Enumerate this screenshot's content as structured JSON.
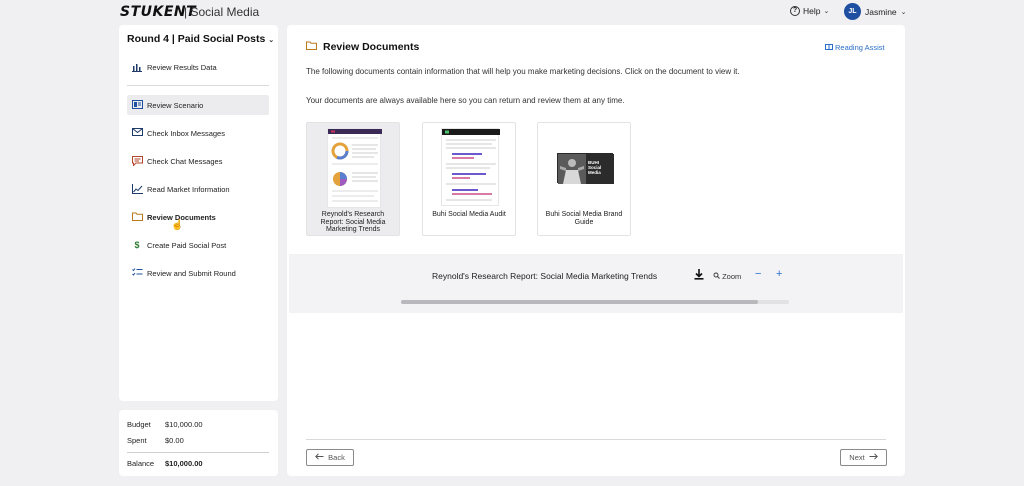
{
  "app": {
    "logo_text": "STUKENT",
    "product": "| Social Media"
  },
  "header": {
    "help_label": "Help",
    "user_initials": "JL",
    "user_name": "Jasmine"
  },
  "sidebar": {
    "round_title": "Round 4 | Paid Social Posts",
    "items": [
      {
        "label": "Review Results Data",
        "icon": "bar-chart-icon"
      },
      {
        "label": "Review Scenario",
        "icon": "scenario-icon",
        "selected": true
      },
      {
        "label": "Check Inbox Messages",
        "icon": "envelope-icon"
      },
      {
        "label": "Check Chat Messages",
        "icon": "chat-icon"
      },
      {
        "label": "Read Market Information",
        "icon": "line-chart-icon"
      },
      {
        "label": "Review Documents",
        "icon": "folder-icon",
        "current": true
      },
      {
        "label": "Create Paid Social Post",
        "icon": "dollar-icon"
      },
      {
        "label": "Review and Submit Round",
        "icon": "checklist-icon"
      }
    ]
  },
  "budget": {
    "budget_label": "Budget",
    "budget_value": "$10,000.00",
    "spent_label": "Spent",
    "spent_value": "$0.00",
    "balance_label": "Balance",
    "balance_value": "$10,000.00"
  },
  "main": {
    "title": "Review Documents",
    "reading_assist": "Reading Assist",
    "intro_1": "The following documents contain information that will help you make marketing decisions. Click on the document to view it.",
    "intro_2": "Your documents are always available here so you can return and review them at any time.",
    "documents": [
      {
        "label": "Reynold's Research Report: Social Media Marketing Trends",
        "active": true
      },
      {
        "label": "Buhi Social Media Audit"
      },
      {
        "label": "Buhi Social Media Brand Guide",
        "thumb_text": "BUHI Social Media"
      }
    ],
    "viewer": {
      "title": "Reynold's Research Report: Social Media Marketing Trends",
      "zoom_label": "Zoom",
      "scroll_fraction": 0.92
    },
    "back_label": "Back",
    "next_label": "Next"
  },
  "colors": {
    "accent": "#2a6fc9",
    "avatar": "#1e4fa0",
    "selected_bg": "#ececee"
  }
}
